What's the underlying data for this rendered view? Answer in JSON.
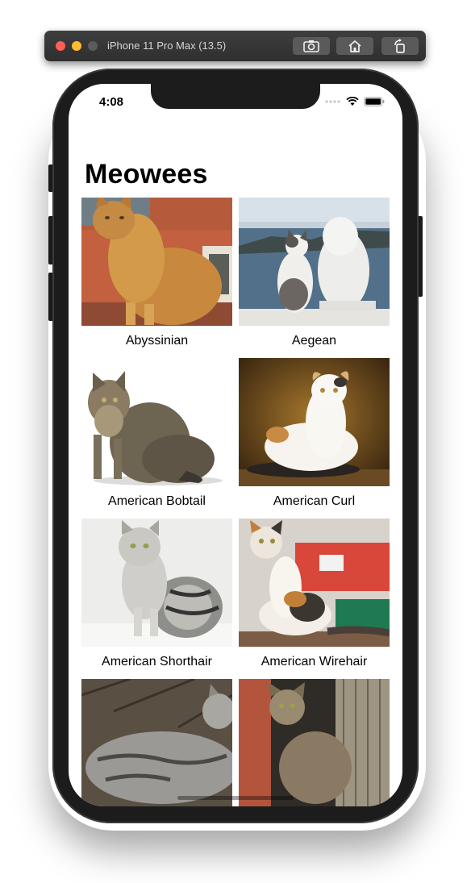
{
  "simulator": {
    "title": "iPhone 11 Pro Max (13.5)",
    "buttons": [
      {
        "name": "screenshot-button",
        "icon": "camera-icon"
      },
      {
        "name": "home-button",
        "icon": "home-icon"
      },
      {
        "name": "rotate-button",
        "icon": "rotate-icon"
      }
    ]
  },
  "status_bar": {
    "time": "4:08",
    "icons": [
      "signal-icon",
      "wifi-icon",
      "battery-icon"
    ]
  },
  "screen": {
    "title": "Meowees"
  },
  "breeds": [
    {
      "label": "Abyssinian"
    },
    {
      "label": "Aegean"
    },
    {
      "label": "American Bobtail"
    },
    {
      "label": "American Curl"
    },
    {
      "label": "American Shorthair"
    },
    {
      "label": "American Wirehair"
    },
    {
      "label": ""
    },
    {
      "label": ""
    }
  ],
  "colors": {
    "toolbar": "#333333",
    "phone_frame": "#1c1c1c",
    "background": "#ffffff"
  }
}
